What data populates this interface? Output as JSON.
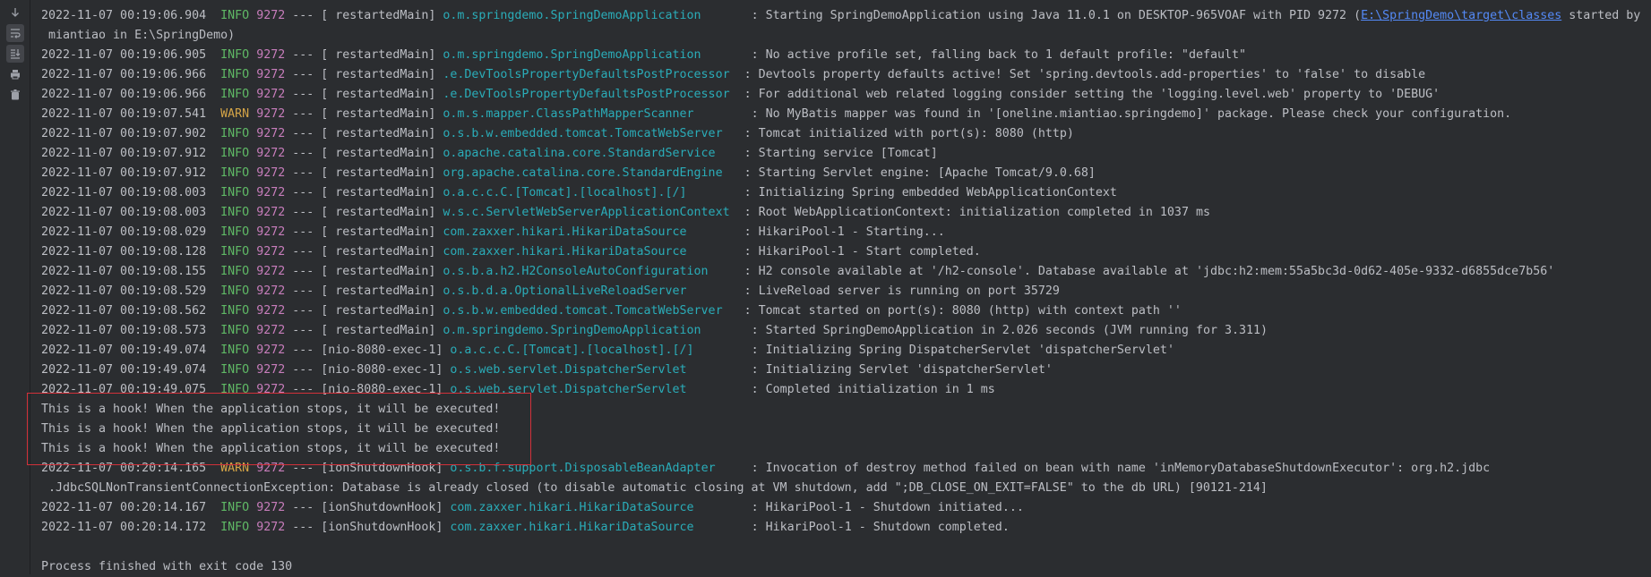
{
  "toolbar": {
    "buttons": [
      {
        "icon": "scroll-down-icon",
        "active": false
      },
      {
        "icon": "soft-wrap-icon",
        "active": true
      },
      {
        "icon": "scroll-to-end-icon",
        "active": true
      },
      {
        "icon": "print-icon",
        "active": false
      },
      {
        "icon": "clear-all-icon",
        "active": false
      }
    ]
  },
  "colors": {
    "info": "#5fb865",
    "warn": "#d4a447",
    "pid": "#c77dbb",
    "logger": "#2aacb8",
    "link": "#548af7",
    "highlight_box": "#d2313a"
  },
  "log": [
    {
      "ts": "2022-11-07 00:19:06.904",
      "level": "INFO",
      "pid": "9272",
      "thread": " restartedMain",
      "logger": "o.m.springdemo.SpringDemoApplication      ",
      "msg_pre": ": Starting SpringDemoApplication using Java 11.0.1 on DESKTOP-965VOAF with PID 9272 (",
      "link": "E:\\SpringDemo\\target\\classes",
      "msg_post": " started by"
    },
    {
      "cont": " miantiao in E:\\SpringDemo)"
    },
    {
      "ts": "2022-11-07 00:19:06.905",
      "level": "INFO",
      "pid": "9272",
      "thread": " restartedMain",
      "logger": "o.m.springdemo.SpringDemoApplication      ",
      "msg_pre": ": No active profile set, falling back to 1 default profile: \"default\""
    },
    {
      "ts": "2022-11-07 00:19:06.966",
      "level": "INFO",
      "pid": "9272",
      "thread": " restartedMain",
      "logger": ".e.DevToolsPropertyDefaultsPostProcessor ",
      "msg_pre": ": Devtools property defaults active! Set 'spring.devtools.add-properties' to 'false' to disable"
    },
    {
      "ts": "2022-11-07 00:19:06.966",
      "level": "INFO",
      "pid": "9272",
      "thread": " restartedMain",
      "logger": ".e.DevToolsPropertyDefaultsPostProcessor ",
      "msg_pre": ": For additional web related logging consider setting the 'logging.level.web' property to 'DEBUG'"
    },
    {
      "ts": "2022-11-07 00:19:07.541",
      "level": "WARN",
      "pid": "9272",
      "thread": " restartedMain",
      "logger": "o.m.s.mapper.ClassPathMapperScanner       ",
      "msg_pre": ": No MyBatis mapper was found in '[oneline.miantiao.springdemo]' package. Please check your configuration."
    },
    {
      "ts": "2022-11-07 00:19:07.902",
      "level": "INFO",
      "pid": "9272",
      "thread": " restartedMain",
      "logger": "o.s.b.w.embedded.tomcat.TomcatWebServer  ",
      "msg_pre": ": Tomcat initialized with port(s): 8080 (http)"
    },
    {
      "ts": "2022-11-07 00:19:07.912",
      "level": "INFO",
      "pid": "9272",
      "thread": " restartedMain",
      "logger": "o.apache.catalina.core.StandardService   ",
      "msg_pre": ": Starting service [Tomcat]"
    },
    {
      "ts": "2022-11-07 00:19:07.912",
      "level": "INFO",
      "pid": "9272",
      "thread": " restartedMain",
      "logger": "org.apache.catalina.core.StandardEngine  ",
      "msg_pre": ": Starting Servlet engine: [Apache Tomcat/9.0.68]"
    },
    {
      "ts": "2022-11-07 00:19:08.003",
      "level": "INFO",
      "pid": "9272",
      "thread": " restartedMain",
      "logger": "o.a.c.c.C.[Tomcat].[localhost].[/]       ",
      "msg_pre": ": Initializing Spring embedded WebApplicationContext"
    },
    {
      "ts": "2022-11-07 00:19:08.003",
      "level": "INFO",
      "pid": "9272",
      "thread": " restartedMain",
      "logger": "w.s.c.ServletWebServerApplicationContext ",
      "msg_pre": ": Root WebApplicationContext: initialization completed in 1037 ms"
    },
    {
      "ts": "2022-11-07 00:19:08.029",
      "level": "INFO",
      "pid": "9272",
      "thread": " restartedMain",
      "logger": "com.zaxxer.hikari.HikariDataSource       ",
      "msg_pre": ": HikariPool-1 - Starting..."
    },
    {
      "ts": "2022-11-07 00:19:08.128",
      "level": "INFO",
      "pid": "9272",
      "thread": " restartedMain",
      "logger": "com.zaxxer.hikari.HikariDataSource       ",
      "msg_pre": ": HikariPool-1 - Start completed."
    },
    {
      "ts": "2022-11-07 00:19:08.155",
      "level": "INFO",
      "pid": "9272",
      "thread": " restartedMain",
      "logger": "o.s.b.a.h2.H2ConsoleAutoConfiguration    ",
      "msg_pre": ": H2 console available at '/h2-console'. Database available at 'jdbc:h2:mem:55a5bc3d-0d62-405e-9332-d6855dce7b56'"
    },
    {
      "ts": "2022-11-07 00:19:08.529",
      "level": "INFO",
      "pid": "9272",
      "thread": " restartedMain",
      "logger": "o.s.b.d.a.OptionalLiveReloadServer       ",
      "msg_pre": ": LiveReload server is running on port 35729"
    },
    {
      "ts": "2022-11-07 00:19:08.562",
      "level": "INFO",
      "pid": "9272",
      "thread": " restartedMain",
      "logger": "o.s.b.w.embedded.tomcat.TomcatWebServer  ",
      "msg_pre": ": Tomcat started on port(s): 8080 (http) with context path ''"
    },
    {
      "ts": "2022-11-07 00:19:08.573",
      "level": "INFO",
      "pid": "9272",
      "thread": " restartedMain",
      "logger": "o.m.springdemo.SpringDemoApplication      ",
      "msg_pre": ": Started SpringDemoApplication in 2.026 seconds (JVM running for 3.311)"
    },
    {
      "ts": "2022-11-07 00:19:49.074",
      "level": "INFO",
      "pid": "9272",
      "thread": "nio-8080-exec-1",
      "logger": "o.a.c.c.C.[Tomcat].[localhost].[/]       ",
      "msg_pre": ": Initializing Spring DispatcherServlet 'dispatcherServlet'"
    },
    {
      "ts": "2022-11-07 00:19:49.074",
      "level": "INFO",
      "pid": "9272",
      "thread": "nio-8080-exec-1",
      "logger": "o.s.web.servlet.DispatcherServlet        ",
      "msg_pre": ": Initializing Servlet 'dispatcherServlet'"
    },
    {
      "ts": "2022-11-07 00:19:49.075",
      "level": "INFO",
      "pid": "9272",
      "thread": "nio-8080-exec-1",
      "logger": "o.s.web.servlet.DispatcherServlet        ",
      "msg_pre": ": Completed initialization in 1 ms"
    },
    {
      "plain": "This is a hook! When the application stops, it will be executed!"
    },
    {
      "plain": "This is a hook! When the application stops, it will be executed!"
    },
    {
      "plain": "This is a hook! When the application stops, it will be executed!"
    },
    {
      "ts": "2022-11-07 00:20:14.165",
      "level": "WARN",
      "pid": "9272",
      "thread": "ionShutdownHook",
      "logger": "o.s.b.f.support.DisposableBeanAdapter    ",
      "msg_pre": ": Invocation of destroy method failed on bean with name 'inMemoryDatabaseShutdownExecutor': org.h2.jdbc"
    },
    {
      "cont": " .JdbcSQLNonTransientConnectionException: Database is already closed (to disable automatic closing at VM shutdown, add \";DB_CLOSE_ON_EXIT=FALSE\" to the db URL) [90121-214]"
    },
    {
      "ts": "2022-11-07 00:20:14.167",
      "level": "INFO",
      "pid": "9272",
      "thread": "ionShutdownHook",
      "logger": "com.zaxxer.hikari.HikariDataSource       ",
      "msg_pre": ": HikariPool-1 - Shutdown initiated..."
    },
    {
      "ts": "2022-11-07 00:20:14.172",
      "level": "INFO",
      "pid": "9272",
      "thread": "ionShutdownHook",
      "logger": "com.zaxxer.hikari.HikariDataSource       ",
      "msg_pre": ": HikariPool-1 - Shutdown completed."
    },
    {
      "plain": ""
    },
    {
      "plain": "Process finished with exit code 130"
    }
  ]
}
